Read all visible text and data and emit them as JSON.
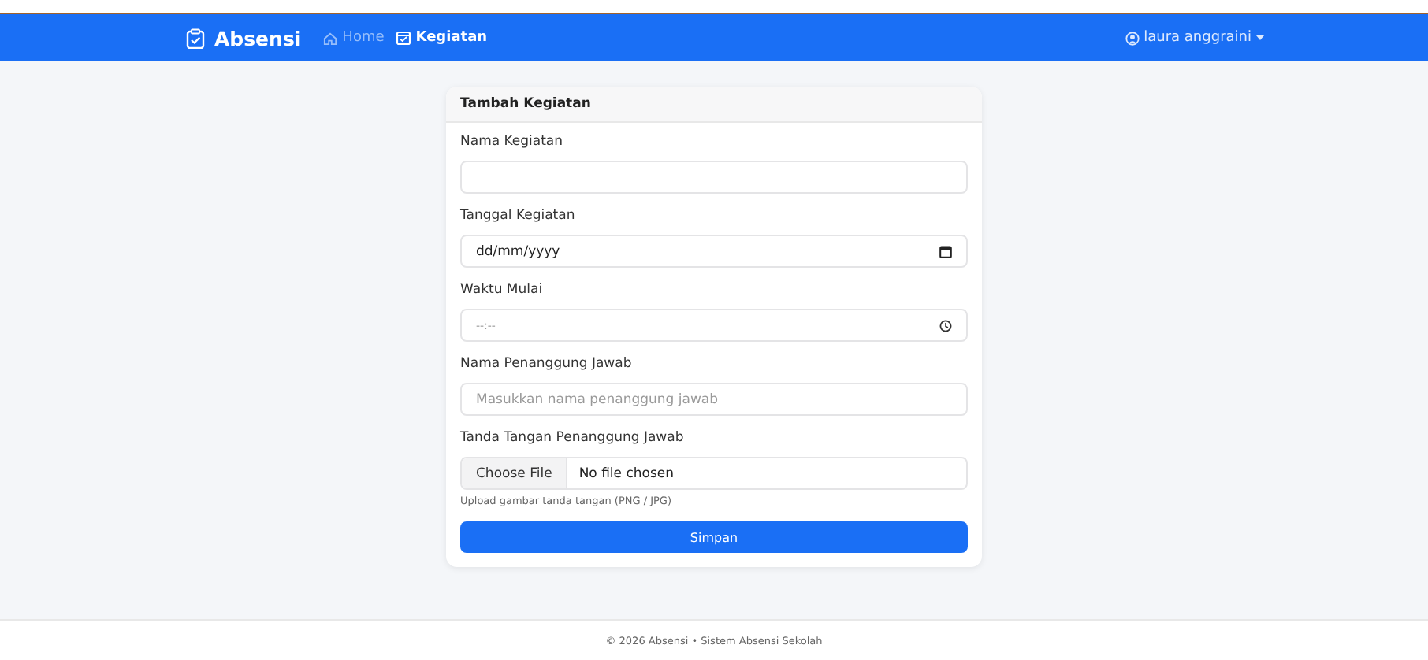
{
  "navbar": {
    "brand": "Absensi",
    "links": [
      {
        "label": "Home",
        "selected": false
      },
      {
        "label": "Kegiatan",
        "selected": true
      }
    ],
    "user": "laura anggraini"
  },
  "card": {
    "title": "Tambah Kegiatan",
    "fields": [
      {
        "kind": "text",
        "label": "Nama Kegiatan"
      },
      {
        "kind": "date",
        "label": "Tanggal Kegiatan",
        "value": "dd/mm/yyyy"
      },
      {
        "kind": "time",
        "label": "Waktu Mulai",
        "value": "--:--"
      },
      {
        "kind": "text",
        "label": "Nama Penanggung Jawab",
        "placeholder": "Masukkan nama penanggung jawab"
      },
      {
        "kind": "file",
        "label": "Tanda Tangan Penanggung Jawab",
        "button": "Choose File",
        "status": "No file chosen",
        "help": "Upload gambar tanda tangan (PNG / JPG)"
      }
    ],
    "submit": "Simpan"
  },
  "footer": "© 2026 Absensi • Sistem Absensi Sekolah"
}
